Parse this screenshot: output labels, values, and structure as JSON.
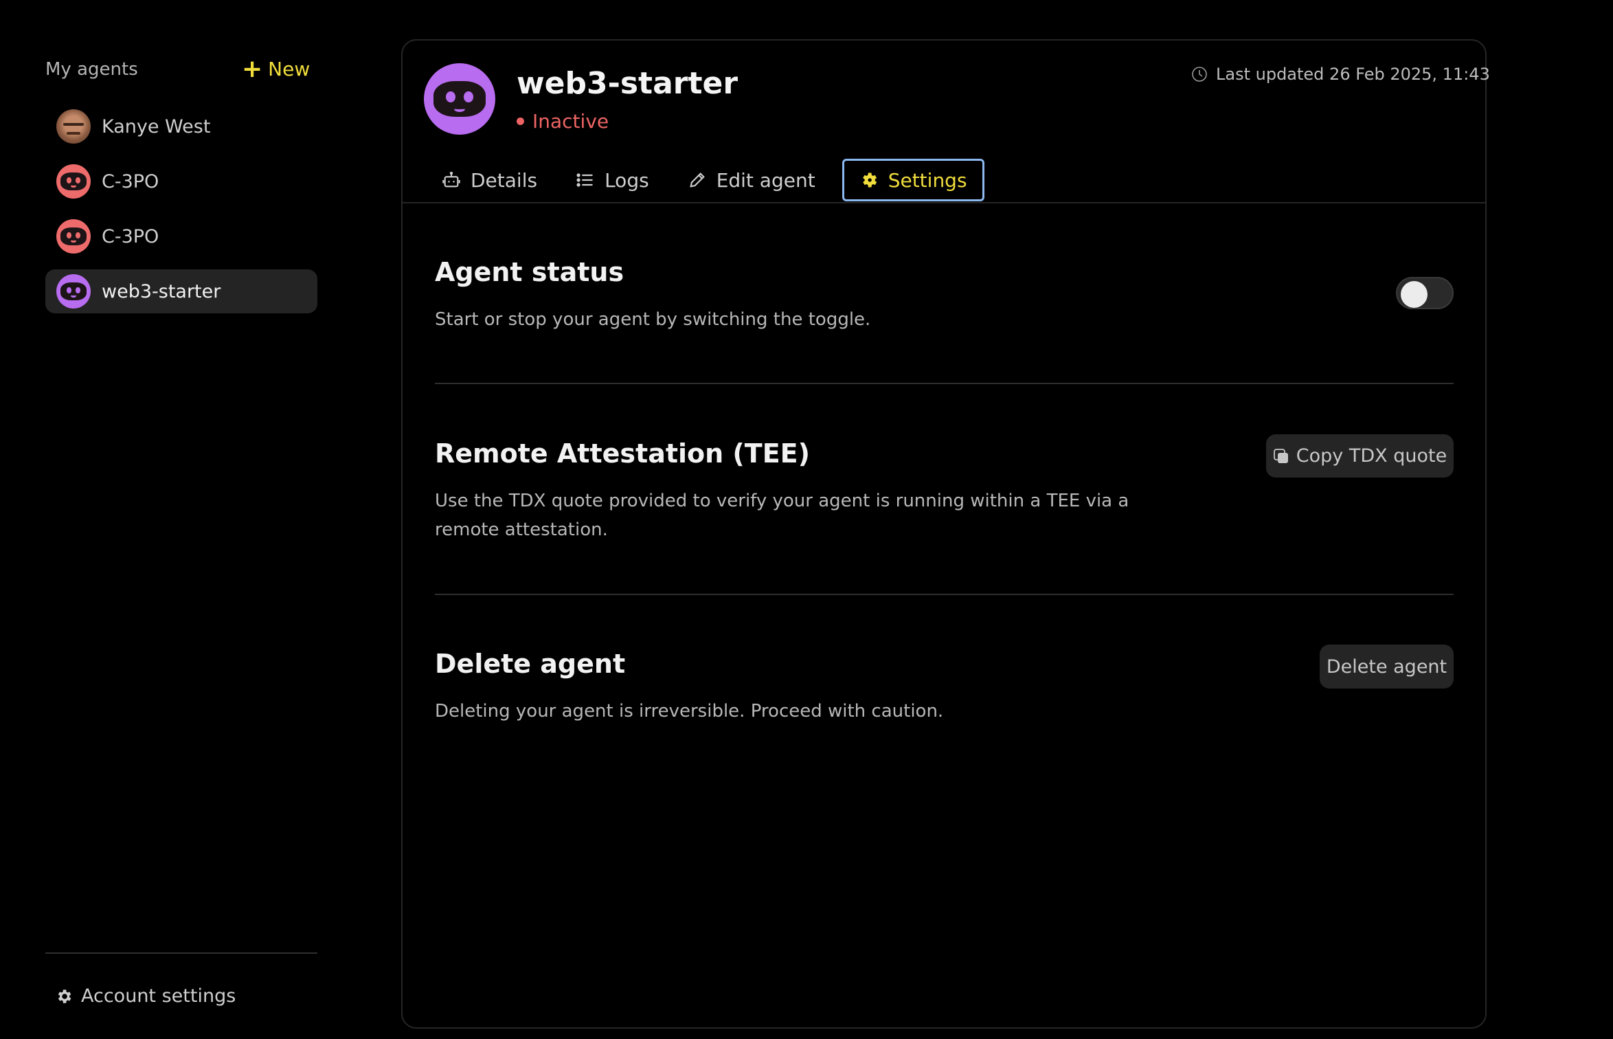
{
  "sidebar": {
    "title": "My agents",
    "new_label": "New",
    "items": [
      {
        "label": "Kanye West",
        "avatar": "photo"
      },
      {
        "label": "C-3PO",
        "avatar": "robot",
        "color": "#ee6b6b"
      },
      {
        "label": "C-3PO",
        "avatar": "robot",
        "color": "#ee6b6b"
      },
      {
        "label": "web3-starter",
        "avatar": "robot",
        "color": "#b86cf0",
        "active": true
      }
    ],
    "account_settings": "Account settings"
  },
  "agent": {
    "name": "web3-starter",
    "status": "Inactive",
    "status_color": "#ee6464",
    "avatar_color": "#b86cf0",
    "last_updated": "Last updated 26 Feb 2025, 11:43"
  },
  "tabs": [
    {
      "label": "Details",
      "icon": "robot-icon"
    },
    {
      "label": "Logs",
      "icon": "list-icon"
    },
    {
      "label": "Edit agent",
      "icon": "pencil-icon"
    },
    {
      "label": "Settings",
      "icon": "gear-icon",
      "active": true
    }
  ],
  "sections": {
    "status": {
      "title": "Agent status",
      "desc": "Start or stop your agent by switching the toggle.",
      "toggle_on": false
    },
    "attestation": {
      "title": "Remote Attestation (TEE)",
      "desc": "Use the TDX quote provided to verify your agent is running within a TEE via a remote attestation.",
      "button": "Copy TDX quote"
    },
    "delete": {
      "title": "Delete agent",
      "desc": "Deleting your agent is irreversible. Proceed with caution.",
      "button": "Delete agent"
    }
  },
  "colors": {
    "accent": "#f0dd3c",
    "focus": "#8cb8f0"
  }
}
